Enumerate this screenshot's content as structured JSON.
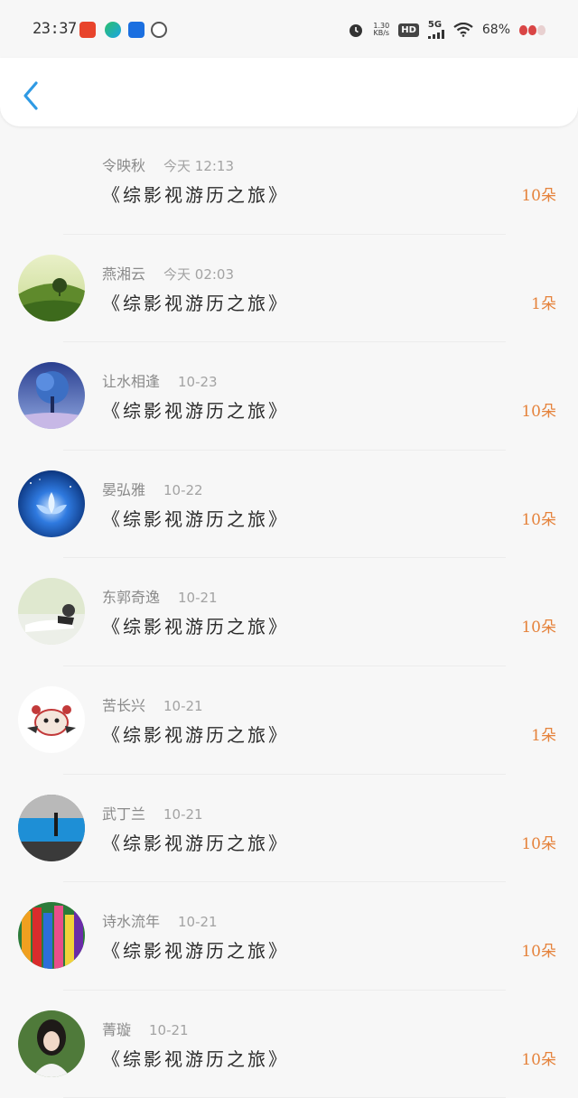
{
  "status_bar": {
    "time": "23:37",
    "net_speed_value": "1.30",
    "net_speed_unit": "KB/s",
    "hd": "HD",
    "network": "5G",
    "battery": "68%"
  },
  "colors": {
    "accent_back": "#2f9ae4",
    "amount": "#e5823b"
  },
  "header": {
    "back_icon": "chevron-left-icon"
  },
  "rows": [
    {
      "name": "令映秋",
      "time": "今天 12:13",
      "book": "《综影视游历之旅》",
      "amount": "10朵",
      "avatar": "none"
    },
    {
      "name": "燕湘云",
      "time": "今天 02:03",
      "book": "《综影视游历之旅》",
      "amount": "1朵",
      "avatar": "green-hill-tree"
    },
    {
      "name": "让水相逢",
      "time": "10-23",
      "book": "《综影视游历之旅》",
      "amount": "10朵",
      "avatar": "blue-tree-night"
    },
    {
      "name": "晏弘雅",
      "time": "10-22",
      "book": "《综影视游历之旅》",
      "amount": "10朵",
      "avatar": "glowing-lotus"
    },
    {
      "name": "东郭奇逸",
      "time": "10-21",
      "book": "《综影视游历之旅》",
      "amount": "10朵",
      "avatar": "person-reclining"
    },
    {
      "name": "苦长兴",
      "time": "10-21",
      "book": "《综影视游历之旅》",
      "amount": "1朵",
      "avatar": "cartoon-bear"
    },
    {
      "name": "武丁兰",
      "time": "10-21",
      "book": "《综影视游历之旅》",
      "amount": "10朵",
      "avatar": "blue-water-figure"
    },
    {
      "name": "诗水流年",
      "time": "10-21",
      "book": "《综影视游历之旅》",
      "amount": "10朵",
      "avatar": "colored-pencils"
    },
    {
      "name": "菁璇",
      "time": "10-21",
      "book": "《综影视游历之旅》",
      "amount": "10朵",
      "avatar": "woman-dark-hair"
    }
  ]
}
